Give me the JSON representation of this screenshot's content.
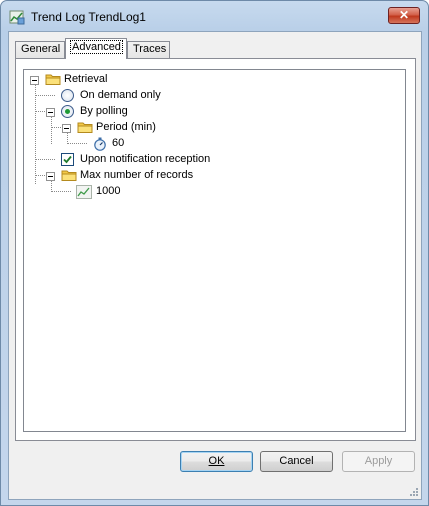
{
  "window": {
    "title": "Trend Log TrendLog1",
    "close_glyph": "✕",
    "icon": "trend-log-app-icon"
  },
  "tabs": [
    {
      "label": "General",
      "active": false
    },
    {
      "label": "Advanced",
      "active": true
    },
    {
      "label": "Traces",
      "active": false
    }
  ],
  "tree": {
    "retrieval": {
      "label": "Retrieval",
      "icon": "folder-icon",
      "expanded": true
    },
    "on_demand": {
      "label": "On demand only",
      "selected": false
    },
    "by_polling": {
      "label": "By polling",
      "selected": true,
      "expanded": true
    },
    "period": {
      "label": "Period (min)",
      "icon": "folder-icon",
      "expanded": true
    },
    "period_value": {
      "label": "60",
      "icon": "stopwatch-icon"
    },
    "notification": {
      "label": "Upon notification reception",
      "checked": true
    },
    "max_records": {
      "label": "Max number of records",
      "icon": "folder-icon",
      "expanded": true
    },
    "max_records_value": {
      "label": "1000",
      "icon": "trend-chart-icon"
    }
  },
  "buttons": {
    "ok": "OK",
    "cancel": "Cancel",
    "apply": "Apply"
  },
  "colors": {
    "radio_selected": "#1f9a35",
    "check_mark": "#1f7a2e",
    "folder": "#f3c948"
  }
}
